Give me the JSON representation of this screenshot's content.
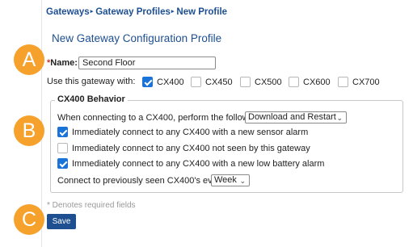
{
  "breadcrumb": {
    "items": [
      "Gateways",
      "Gateway Profiles",
      "New Profile"
    ],
    "separator": "▸"
  },
  "page_title": "New Gateway Configuration Profile",
  "markers": {
    "a": "A",
    "b": "B",
    "c": "C",
    "color": "#f5a12b"
  },
  "name_field": {
    "required_mark": "*",
    "label": "Name:",
    "value": "Second Floor"
  },
  "gateway_use": {
    "label": "Use this gateway with:",
    "options": [
      {
        "label": "CX400",
        "checked": true
      },
      {
        "label": "CX450",
        "checked": false
      },
      {
        "label": "CX500",
        "checked": false
      },
      {
        "label": "CX600",
        "checked": false
      },
      {
        "label": "CX700",
        "checked": false
      }
    ]
  },
  "behavior": {
    "legend": "CX400 Behavior",
    "connect_label": "When connecting to a CX400, perform the following",
    "connect_action": "Download and Restart",
    "options": [
      {
        "label": "Immediately connect to any CX400 with a new sensor alarm",
        "checked": true
      },
      {
        "label": "Immediately connect to any CX400 not seen by this gateway",
        "checked": false
      },
      {
        "label": "Immediately connect to any CX400 with a new low battery alarm",
        "checked": true
      }
    ],
    "frequency_label": "Connect to previously seen CX400's every",
    "frequency_value": "Week"
  },
  "required_note": "* Denotes required fields",
  "save_label": "Save",
  "colors": {
    "link": "#1d4f91",
    "accent": "#1a73d9",
    "button": "#1d4f91"
  }
}
